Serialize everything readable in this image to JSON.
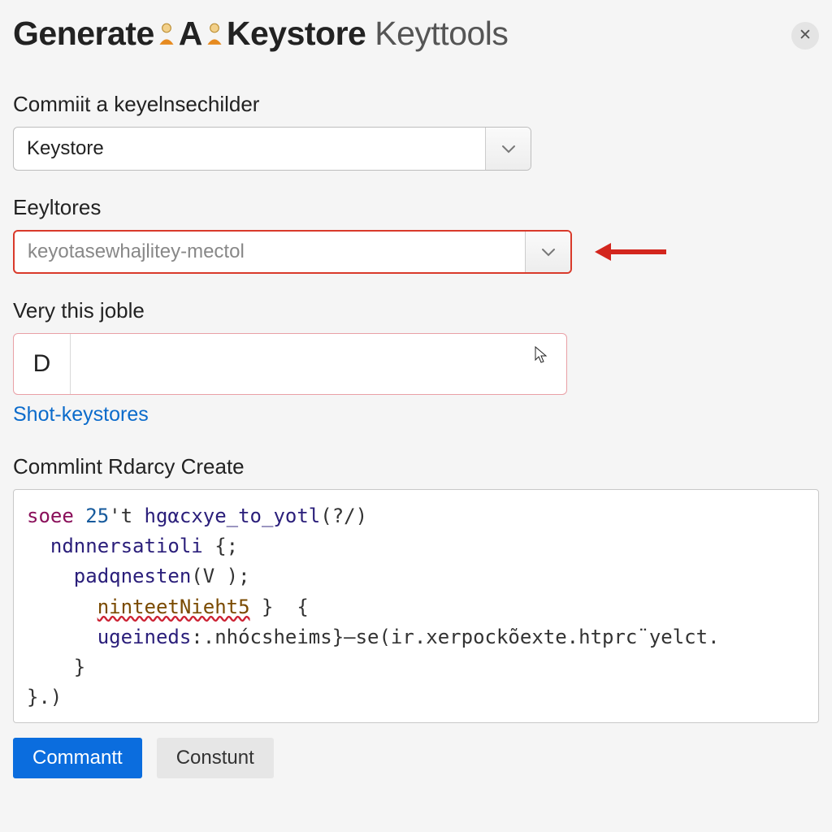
{
  "header": {
    "title_part1": "Generate",
    "title_part2": "A",
    "title_part3": "Keystore",
    "title_part4": "Keyttools"
  },
  "fields": {
    "keystore_select": {
      "label": "Commiit a keyelnsechilder",
      "value": "Keystore"
    },
    "eeyltores": {
      "label": "Eeyltores",
      "placeholder": "keyotasewhajlitey-mectol"
    },
    "job": {
      "label": "Very this joble",
      "prefix": "D",
      "value": ""
    },
    "shot_link": "Shot-keystores",
    "command": {
      "label": "Commlint Rdarcy Create",
      "line1_a": "soee",
      "line1_b": "25",
      "line1_c": "'t",
      "line1_d": "hgαcxye_to_yotl",
      "line1_e": "(?/)",
      "line2_a": "ndnnersatioli",
      "line2_b": "{;",
      "line3_a": "padqnesten",
      "line3_b": "(V );",
      "line4_a": "ninteetNieht5",
      "line4_b": " }  {",
      "line5_a": "ugeineds",
      "line5_b": ":.nhócsheims}—se(ir.xerpockõexte.htprc¨yelct.",
      "line6": "    }",
      "line7": "}.)"
    }
  },
  "buttons": {
    "primary": "Commantt",
    "secondary": "Constunt"
  }
}
